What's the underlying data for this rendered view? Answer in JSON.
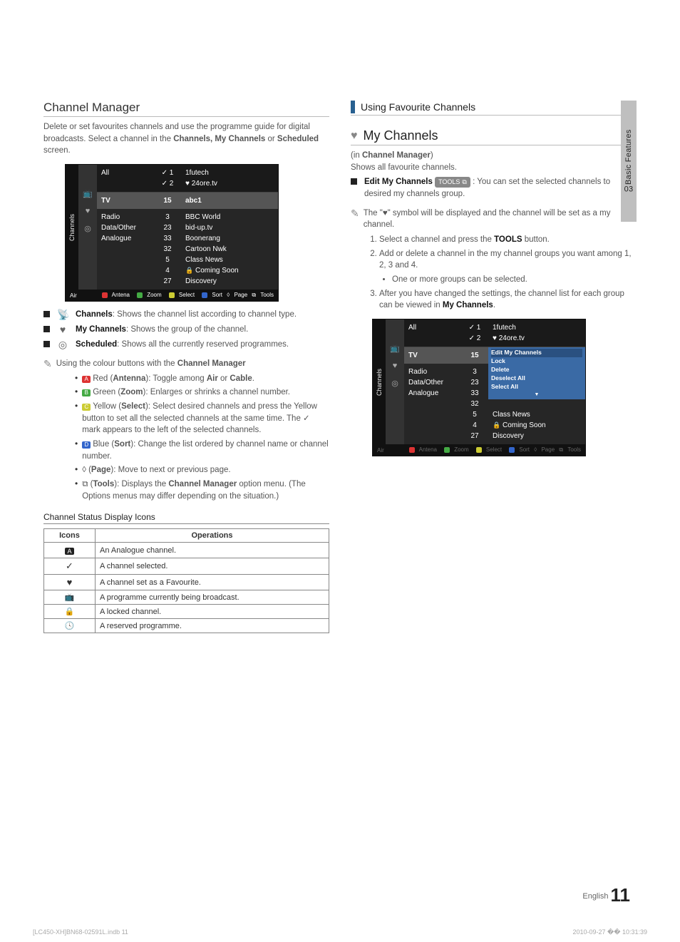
{
  "sideTab": {
    "num": "03",
    "label": "Basic Features"
  },
  "left": {
    "title": "Channel Manager",
    "lead": "Delete or set favourites channels and use the programme guide for digital broadcasts. Select a channel in the ",
    "lead_bold": "Channels, My Channels",
    "lead_or": " or ",
    "lead_bold2": "Scheduled",
    "lead_end": " screen.",
    "fig1": {
      "side": "Channels",
      "topLeft": "All",
      "top_chk1": "✓ 1",
      "top_chk2": "✓ 2",
      "top_r1": "1futech",
      "top_r2": "24ore.tv",
      "hi_tv": "TV",
      "hi_num": "15",
      "hi_name": "abc1",
      "listA": [
        "Radio",
        "Data/Other",
        "Analogue"
      ],
      "listNums": [
        "3",
        "23",
        "33",
        "32",
        "5",
        "4",
        "27"
      ],
      "listNames": [
        "BBC World",
        "bid-up.tv",
        "Boonerang",
        "Cartoon Nwk",
        "Class News",
        "Coming Soon",
        "Discovery"
      ],
      "foot_air": "Air",
      "foot_btns": {
        "a": "Antena",
        "b": "Zoom",
        "c": "Select",
        "d": "Sort",
        "e": "Page",
        "f": "Tools"
      }
    },
    "legend": [
      {
        "label": "Channels",
        "desc": ": Shows the channel list according to channel type."
      },
      {
        "label": "My Channels",
        "desc": ": Shows the group of the channel."
      },
      {
        "label": "Scheduled",
        "desc": ": Shows all the currently reserved programmes."
      }
    ],
    "note_text": "Using the colour buttons with the ",
    "note_bold": "Channel Manager",
    "colour_items": [
      {
        "c": "A",
        "lbl": "Red",
        "bold": "Antenna",
        "desc": ": Toggle among ",
        "b2": "Air",
        "mid": " or ",
        "b3": "Cable",
        "end": "."
      },
      {
        "c": "B",
        "lbl": "Green",
        "bold": "Zoom",
        "desc": ": Enlarges or shrinks a channel number."
      },
      {
        "c": "C",
        "lbl": "Yellow",
        "bold": "Select",
        "desc": ": Select desired channels and press the Yellow button to set all the selected channels at the same time. The ✓ mark appears to the left of the selected channels."
      },
      {
        "c": "D",
        "lbl": "Blue",
        "bold": "Sort",
        "desc": ": Change the list ordered by channel name or channel number."
      },
      {
        "c": "",
        "lbl": "◊",
        "bold": "Page",
        "desc": ": Move to next or previous page."
      },
      {
        "c": "",
        "lbl": "⧉",
        "bold": "Tools",
        "desc": ": Displays the ",
        "b2": "Channel Manager",
        "end": " option menu. (The Options menus may differ depending on the situation.)"
      }
    ],
    "status_head": "Channel Status Display Icons",
    "status_cols": [
      "Icons",
      "Operations"
    ],
    "status_rows": [
      {
        "i": "A",
        "iclass": "sm-a",
        "t": "An Analogue channel."
      },
      {
        "i": "✓",
        "t": "A channel selected."
      },
      {
        "i": "♥",
        "t": "A channel set as a Favourite."
      },
      {
        "i": "📺",
        "t": "A programme currently being broadcast."
      },
      {
        "i": "🔒",
        "t": "A locked channel."
      },
      {
        "i": "🕓",
        "t": "A reserved programme."
      }
    ]
  },
  "right": {
    "barTitle": "Using Favourite Channels",
    "heartTitle": "My Channels",
    "in_text": "(in ",
    "in_bold": "Channel Manager",
    "in_end": ")",
    "shows": "Shows all favourite channels.",
    "edit_label": "Edit My Channels",
    "tools_badge": "TOOLS",
    "edit_desc": " : You can set the selected channels to desired my channels group.",
    "note2a": "The \"",
    "note2b": "\" symbol will be displayed and the channel will be set as a my channel.",
    "steps": [
      "Select a channel and press the TOOLS button.",
      "Add or delete a channel in the my channel groups you want among 1, 2, 3 and 4.",
      "After you have changed the settings, the channel list for each group can be viewed in My Channels."
    ],
    "step2_sub": "One or more groups can be selected.",
    "fig2": {
      "side": "Channels",
      "popup": [
        "Edit My Channels",
        "Lock",
        "Delete",
        "Deselect All",
        "Select All"
      ],
      "listNums2": [
        "3",
        "23",
        "33",
        "32",
        "5",
        "4",
        "27"
      ],
      "listNames2": [
        "",
        "",
        "",
        "",
        "Class News",
        "Coming Soon",
        "Discovery"
      ]
    }
  },
  "footer": {
    "lang": "English",
    "page": "11"
  },
  "meta": {
    "left": "[LC450-XH]BN68-02591L.indb   11",
    "right": "2010-09-27   �� 10:31:39"
  }
}
